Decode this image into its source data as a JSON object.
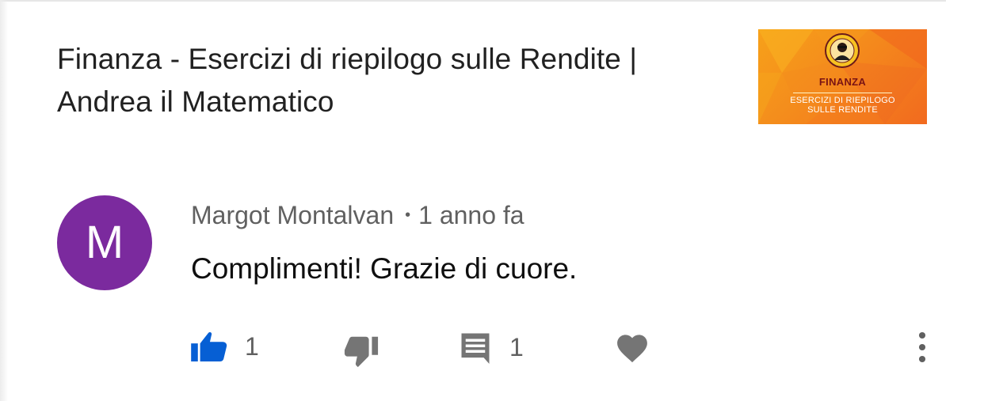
{
  "video": {
    "title": "Finanza - Esercizi di riepilogo sulle Rendite | Andrea il Matematico",
    "thumbnail": {
      "title": "FINANZA",
      "subtitle_line1": "ESERCIZI DI RIEPILOGO",
      "subtitle_line2": "SULLE RENDITE"
    }
  },
  "comment": {
    "avatar_letter": "M",
    "author": "Margot Montalvan",
    "separator": "•",
    "time": "1 anno fa",
    "text": "Complimenti! Grazie di cuore.",
    "like_count": "1",
    "reply_count": "1"
  },
  "icons": {
    "like": "thumbs-up-icon",
    "dislike": "thumbs-down-icon",
    "reply": "comment-icon",
    "heart": "heart-icon",
    "more": "more-vertical-icon"
  },
  "colors": {
    "avatar_bg": "#7b2a9e",
    "like_active": "#065fd4",
    "icon_gray": "#757575",
    "thumbnail_orange": "#f48b1c"
  }
}
